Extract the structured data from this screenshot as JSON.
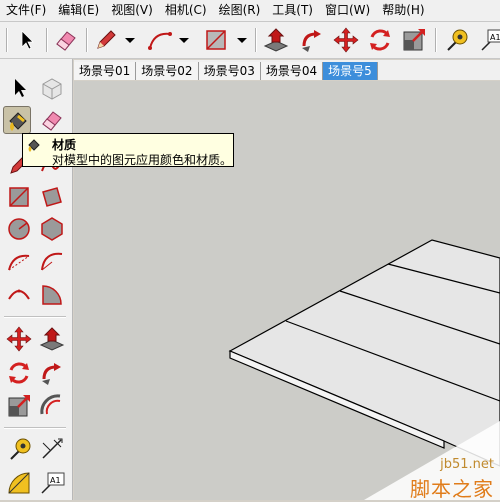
{
  "menu": [
    "文件(F)",
    "编辑(E)",
    "视图(V)",
    "相机(C)",
    "绘图(R)",
    "工具(T)",
    "窗口(W)",
    "帮助(H)"
  ],
  "toolbar": {
    "icons": [
      "select-icon",
      "eraser-icon",
      "pencil-icon",
      "arc-icon",
      "rectangle-icon",
      "push-pull-icon",
      "follow-me-icon",
      "move-icon",
      "rotate-icon",
      "scale-icon",
      "tape-measure-icon",
      "text-icon"
    ],
    "text_tool_label": "A1"
  },
  "scene_tabs": [
    {
      "label": "场景号01"
    },
    {
      "label": "场景号02"
    },
    {
      "label": "场景号03"
    },
    {
      "label": "场景号04"
    },
    {
      "label": "场景号5"
    }
  ],
  "active_scene_index": 4,
  "left_tools": {
    "icons": [
      "select-icon",
      "component-icon",
      "paint-bucket-icon",
      "eraser-icon",
      "pencil-icon",
      "freehand-icon",
      "rectangle-icon",
      "rotated-rectangle-icon",
      "circle-icon",
      "polygon-icon",
      "arc-icon",
      "arc-2-icon",
      "arc-3-icon",
      "pie-icon",
      "move-icon",
      "push-pull-icon",
      "rotate-icon",
      "follow-me-icon",
      "scale-icon",
      "offset-icon",
      "tape-measure-icon",
      "dimension-icon",
      "protractor-icon",
      "text-icon"
    ],
    "text_tool_label": "A1",
    "active": "paint-bucket-icon"
  },
  "tooltip": {
    "title": "材质",
    "description": "对模型中的图元应用颜色和材质。"
  },
  "watermark": {
    "url": "jb51.net",
    "text": "脚本之家"
  },
  "colors": {
    "viewport_bg": "#ccccc8",
    "active_tab": "#3d8edb",
    "tooltip_bg": "#ffffe1",
    "face_fill": "#e6e6e6",
    "edge_stroke": "#000000",
    "watermark": "#e07c1a"
  }
}
